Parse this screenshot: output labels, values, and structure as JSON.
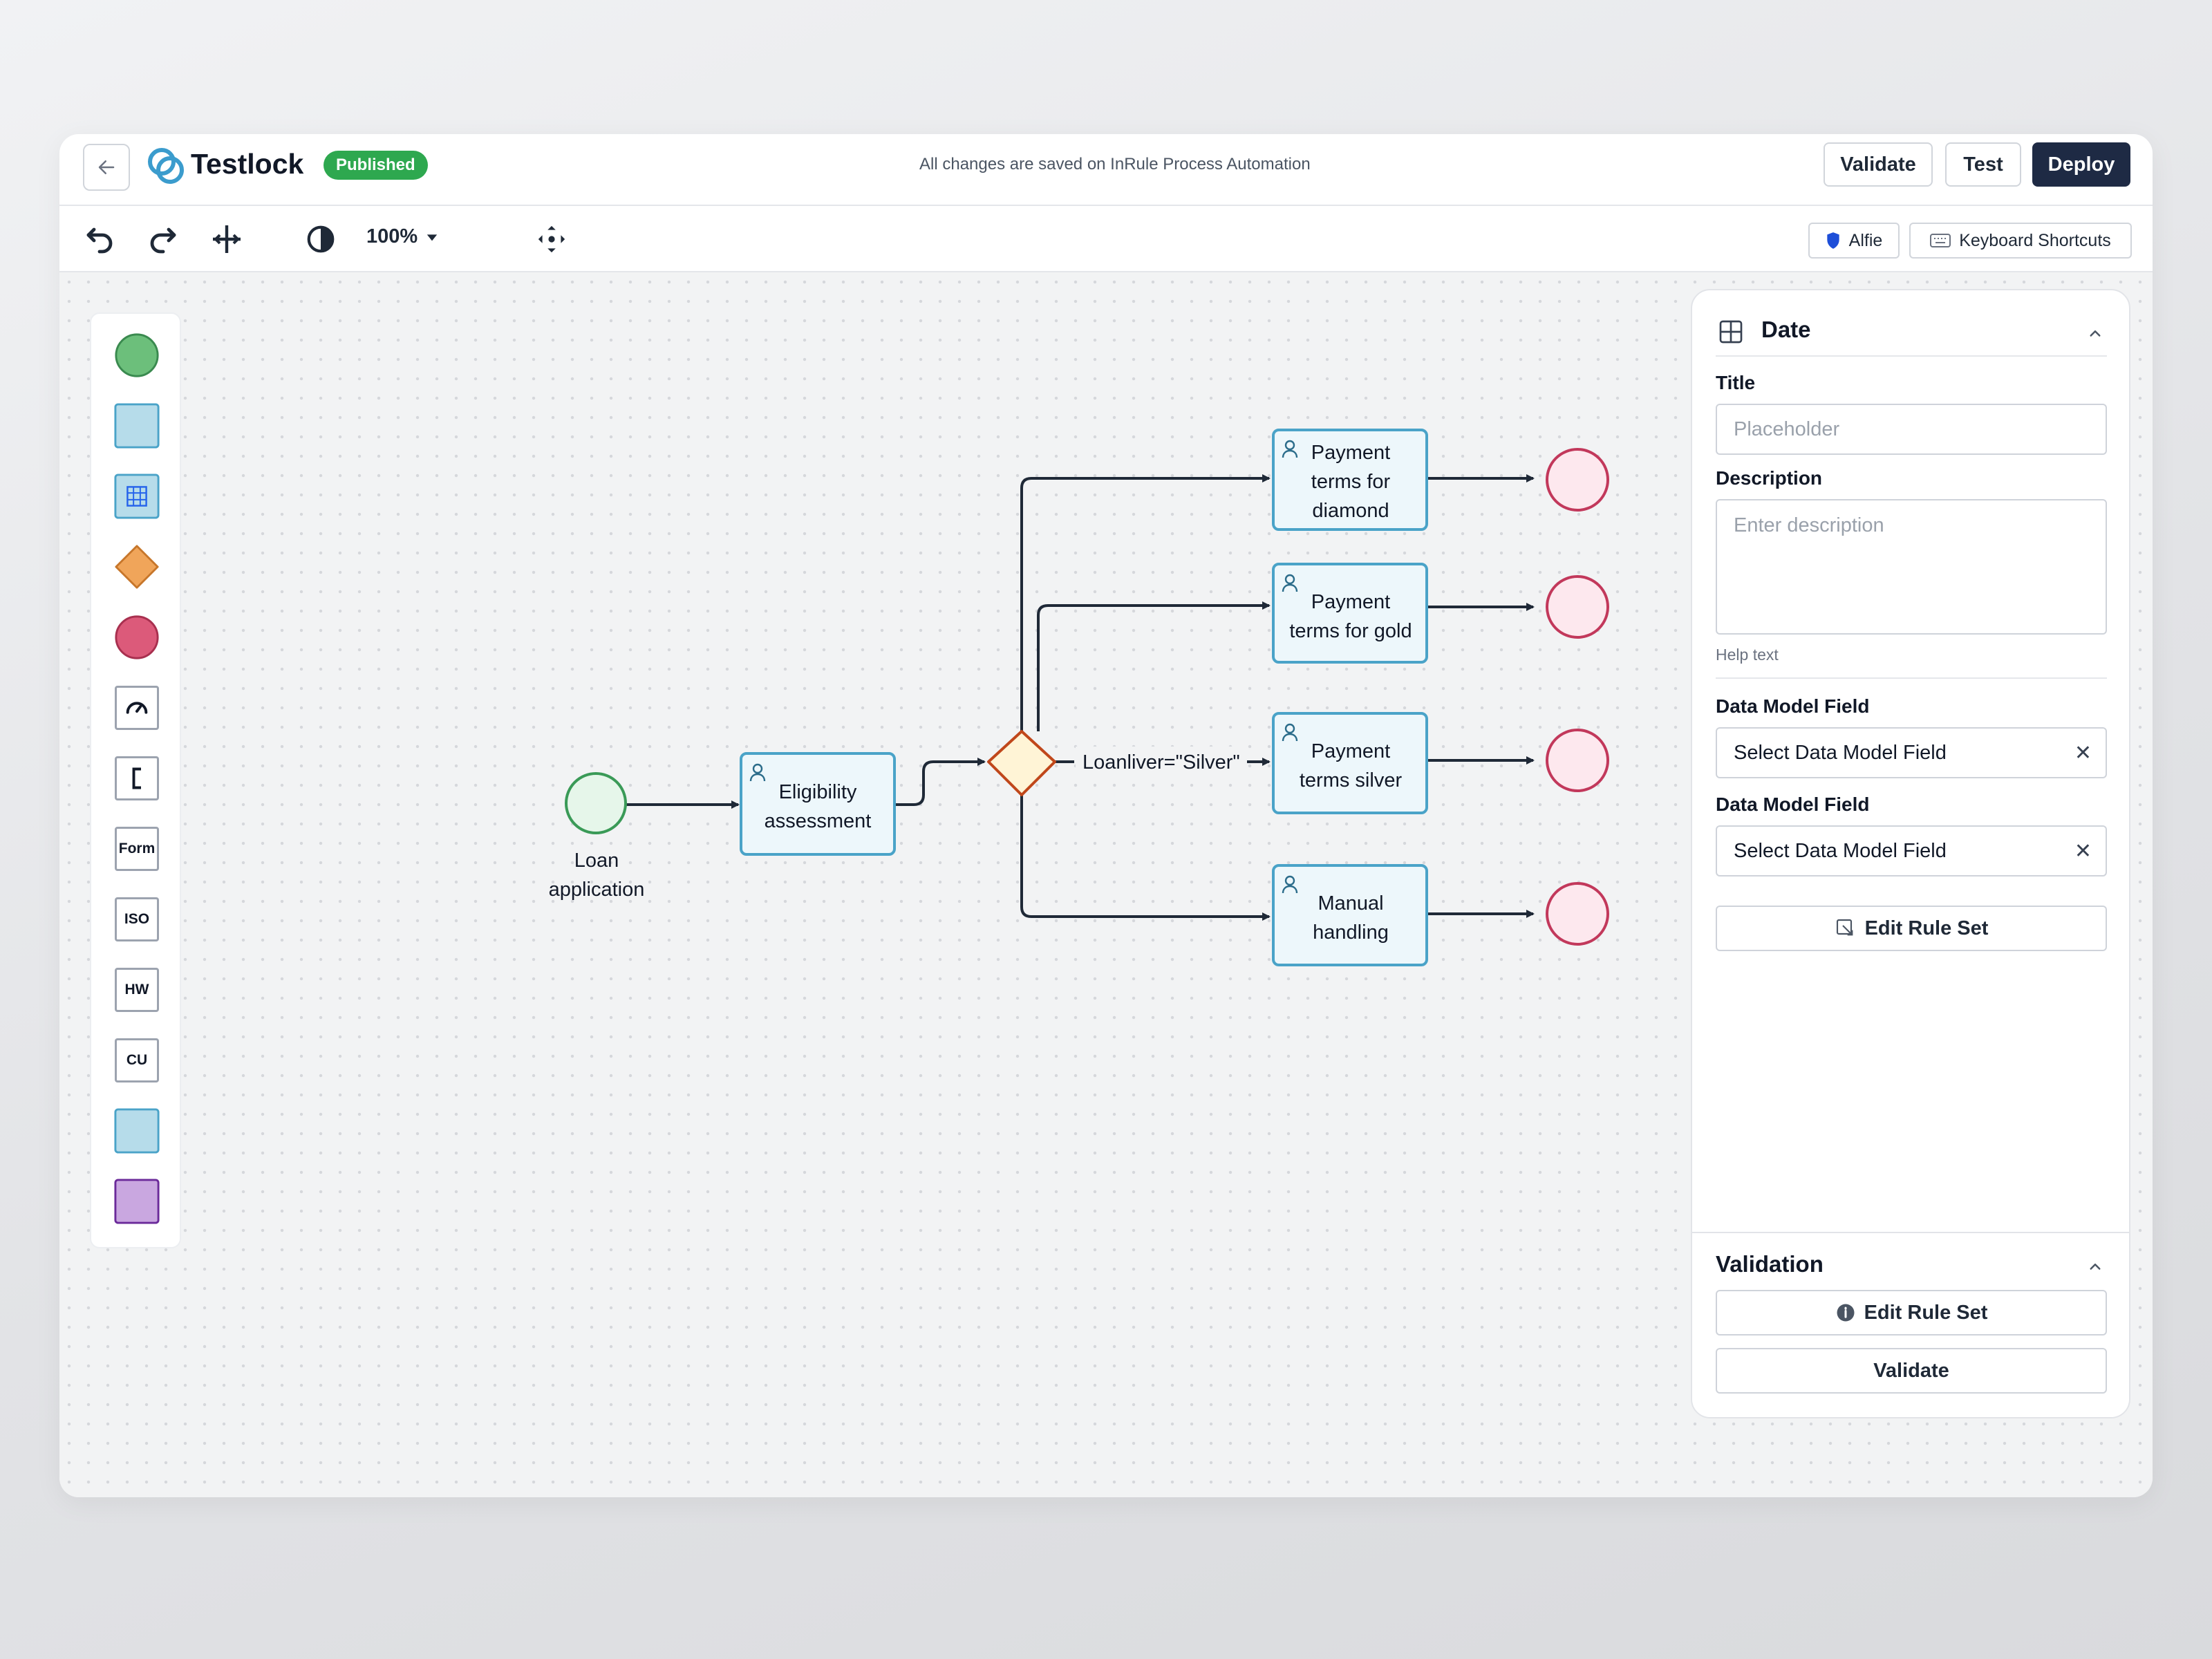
{
  "app": {
    "title": "Testlock",
    "status_badge": "Published",
    "save_status": "All changes are saved on InRule Process Automation"
  },
  "header_actions": {
    "validate": "Validate",
    "test": "Test",
    "deploy": "Deploy"
  },
  "toolbar": {
    "zoom": "100%",
    "alfie": "Alfie",
    "shortcuts": "Keyboard Shortcuts"
  },
  "palette": {
    "items": [
      {
        "name": "start-event",
        "label": ""
      },
      {
        "name": "task",
        "label": ""
      },
      {
        "name": "data-table",
        "label": ""
      },
      {
        "name": "gateway",
        "label": ""
      },
      {
        "name": "end-event",
        "label": ""
      },
      {
        "name": "timer",
        "label": ""
      },
      {
        "name": "annotation",
        "label": ""
      },
      {
        "name": "form",
        "label": "Form"
      },
      {
        "name": "iso",
        "label": "ISO"
      },
      {
        "name": "hw",
        "label": "HW"
      },
      {
        "name": "cu",
        "label": "CU"
      },
      {
        "name": "subprocess",
        "label": ""
      },
      {
        "name": "custom",
        "label": ""
      }
    ]
  },
  "diagram": {
    "start_label_line1": "Loan",
    "start_label_line2": "application",
    "task_eligibility": [
      "Eligibility",
      "assessment"
    ],
    "task_diamond": [
      "Payment",
      "terms for",
      "diamond"
    ],
    "task_gold": [
      "Payment",
      "terms for gold"
    ],
    "task_silver": [
      "Payment",
      "terms silver"
    ],
    "task_manual": [
      "Manual",
      "handling"
    ],
    "condition_label": "Loanliver=\"Silver\""
  },
  "panel": {
    "title": "Date",
    "title_label": "Title",
    "title_placeholder": "Placeholder",
    "description_label": "Description",
    "description_placeholder": "Enter description",
    "help_text": "Help text",
    "data_model_field_1_label": "Data Model Field",
    "data_model_field_1_value": "Select Data Model Field",
    "data_model_field_2_label": "Data Model Field",
    "data_model_field_2_value": "Select Data Model Field",
    "edit_rule_set": "Edit Rule Set",
    "validation": {
      "title": "Validation",
      "edit_rule_set": "Edit Rule Set",
      "validate": "Validate"
    }
  },
  "colors": {
    "accent_dark": "#1e2a44",
    "published_green": "#2ea84f",
    "start_green": "#3a9a57",
    "task_blue": "#4aa3c8",
    "gateway_orange": "#c0471b",
    "end_red": "#c2385b"
  }
}
